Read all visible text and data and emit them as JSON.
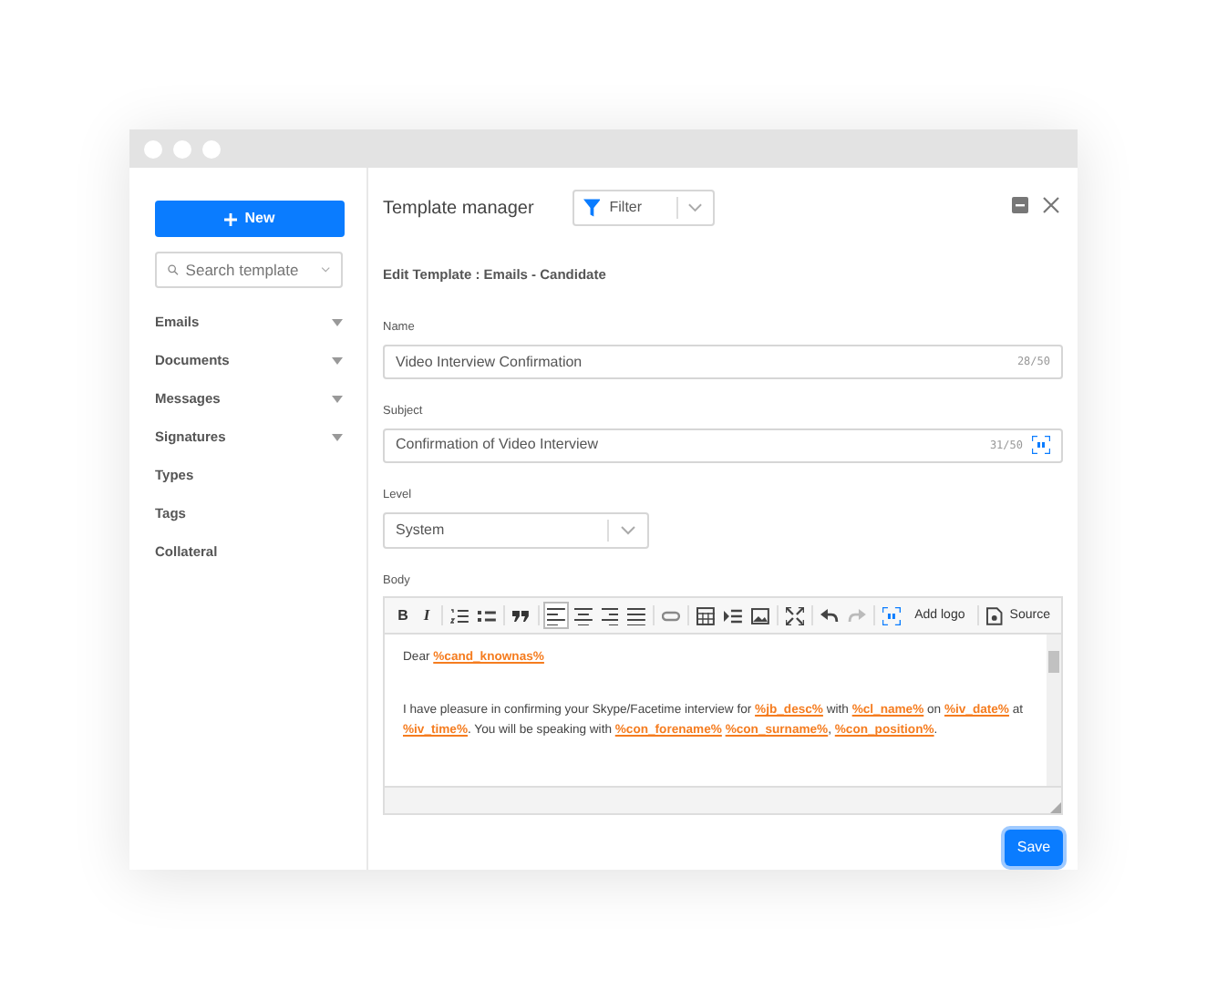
{
  "sidebar": {
    "new_button": "New",
    "search": {
      "placeholder": "Search template"
    },
    "items": [
      {
        "label": "Emails",
        "expandable": true
      },
      {
        "label": "Documents",
        "expandable": true
      },
      {
        "label": "Messages",
        "expandable": true
      },
      {
        "label": "Signatures",
        "expandable": true
      },
      {
        "label": "Types",
        "expandable": false
      },
      {
        "label": "Tags",
        "expandable": false
      },
      {
        "label": "Collateral",
        "expandable": false
      }
    ]
  },
  "header": {
    "title": "Template manager",
    "filter": "Filter"
  },
  "subtitle": "Edit Template : Emails - Candidate",
  "fields": [
    {
      "label": "Name",
      "value": "Video Interview Confirmation",
      "counter": "28/50",
      "kind": "text"
    },
    {
      "label": "Subject",
      "value": "Confirmation of Video Interview",
      "counter": "31/50",
      "kind": "text_with_tag"
    },
    {
      "label": "Level",
      "value": "System",
      "kind": "select"
    }
  ],
  "body": {
    "label": "Body",
    "toolbar": [
      {
        "kind": "bold",
        "label": "B",
        "selected": false
      },
      {
        "kind": "italic",
        "label": "I",
        "selected": false
      },
      {
        "kind": "sep"
      },
      {
        "kind": "ordered-list",
        "selected": false
      },
      {
        "kind": "bullet-list",
        "selected": false
      },
      {
        "kind": "sep"
      },
      {
        "kind": "quote",
        "selected": false
      },
      {
        "kind": "sep"
      },
      {
        "kind": "align-left",
        "selected": true
      },
      {
        "kind": "align-center",
        "selected": false
      },
      {
        "kind": "align-right",
        "selected": false
      },
      {
        "kind": "justify",
        "selected": false
      },
      {
        "kind": "sep"
      },
      {
        "kind": "link",
        "selected": false
      },
      {
        "kind": "sep"
      },
      {
        "kind": "table",
        "selected": false
      },
      {
        "kind": "indent",
        "selected": false
      },
      {
        "kind": "image",
        "selected": false
      },
      {
        "kind": "sep"
      },
      {
        "kind": "fullscreen",
        "selected": false
      },
      {
        "kind": "sep"
      },
      {
        "kind": "undo",
        "selected": false
      },
      {
        "kind": "redo",
        "selected": false
      },
      {
        "kind": "sep"
      },
      {
        "kind": "tag",
        "selected": false
      },
      {
        "kind": "text",
        "label": "Add logo",
        "selected": false
      },
      {
        "kind": "sep"
      },
      {
        "kind": "source",
        "label": "Source",
        "selected": false
      }
    ],
    "paragraphs": [
      [
        {
          "text": "Dear "
        },
        {
          "text": "%cand_knownas%",
          "kind": "merge_field"
        }
      ],
      [
        {
          "text": "I have pleasure in confirming your Skype/Facetime interview for "
        },
        {
          "text": "%jb_desc%",
          "kind": "merge_field"
        },
        {
          "text": " with "
        },
        {
          "text": "%cl_name%",
          "kind": "merge_field"
        },
        {
          "text": " on "
        },
        {
          "text": "%iv_date%",
          "kind": "merge_field"
        },
        {
          "text": " at "
        },
        {
          "text": "%iv_time%",
          "kind": "merge_field"
        },
        {
          "text": ". You will be speaking with "
        },
        {
          "text": "%con_forename%",
          "kind": "merge_field"
        },
        {
          "text": "%con_surname%",
          "kind": "merge_field",
          "space_before": true
        },
        {
          "text": ", "
        },
        {
          "text": "%con_position%",
          "kind": "merge_field"
        },
        {
          "text": "."
        }
      ]
    ]
  },
  "save_button": "Save"
}
